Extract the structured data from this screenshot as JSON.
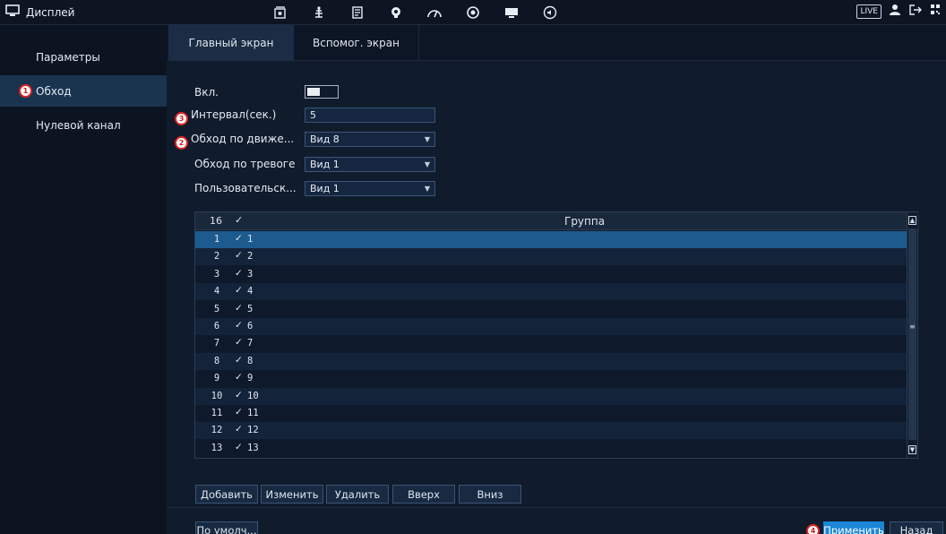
{
  "window": {
    "title": "Дисплей"
  },
  "topbar": {
    "icons": [
      "camera-icon",
      "network-icon",
      "storage-icon",
      "system-icon",
      "performance-icon",
      "maintenance-icon",
      "display-icon",
      "audio-icon"
    ],
    "live_label": "LIVE",
    "user_icon": "user-icon",
    "logout_icon": "logout-icon",
    "qr_icon": "qr-icon"
  },
  "sidebar": {
    "items": [
      {
        "label": "Параметры",
        "active": false
      },
      {
        "label": "Обход",
        "active": true,
        "badge": "1"
      },
      {
        "label": "Нулевой канал",
        "active": false
      }
    ]
  },
  "tabs": [
    {
      "label": "Главный экран",
      "active": true
    },
    {
      "label": "Вспомог. экран",
      "active": false
    }
  ],
  "form": {
    "enable_label": "Вкл.",
    "enable_on": false,
    "interval_label": "Интервал(сек.)",
    "interval_badge": "3",
    "interval_value": "5",
    "motion_label": "Обход по движе...",
    "motion_badge": "2",
    "motion_value": "Вид 8",
    "alarm_label": "Обход по тревоге",
    "alarm_value": "Вид 1",
    "custom_label": "Пользовательск...",
    "custom_value": "Вид 1"
  },
  "table": {
    "header": {
      "count": "16",
      "check": "✓",
      "group": "Группа"
    },
    "rows": [
      {
        "n": "1",
        "v": "1"
      },
      {
        "n": "2",
        "v": "2"
      },
      {
        "n": "3",
        "v": "3"
      },
      {
        "n": "4",
        "v": "4"
      },
      {
        "n": "5",
        "v": "5"
      },
      {
        "n": "6",
        "v": "6"
      },
      {
        "n": "7",
        "v": "7"
      },
      {
        "n": "8",
        "v": "8"
      },
      {
        "n": "9",
        "v": "9"
      },
      {
        "n": "10",
        "v": "10"
      },
      {
        "n": "11",
        "v": "11"
      },
      {
        "n": "12",
        "v": "12"
      },
      {
        "n": "13",
        "v": "13"
      }
    ],
    "check_mark": "✓"
  },
  "buttons": {
    "add": "Добавить",
    "edit": "Изменить",
    "delete": "Удалить",
    "up": "Вверх",
    "down": "Вниз",
    "default": "По умолч...",
    "apply": "Применить",
    "apply_badge": "4",
    "back": "Назад"
  },
  "colors": {
    "accent": "#1b86d6",
    "selected_row": "#1d5b8f",
    "badge_border": "#e12323"
  }
}
